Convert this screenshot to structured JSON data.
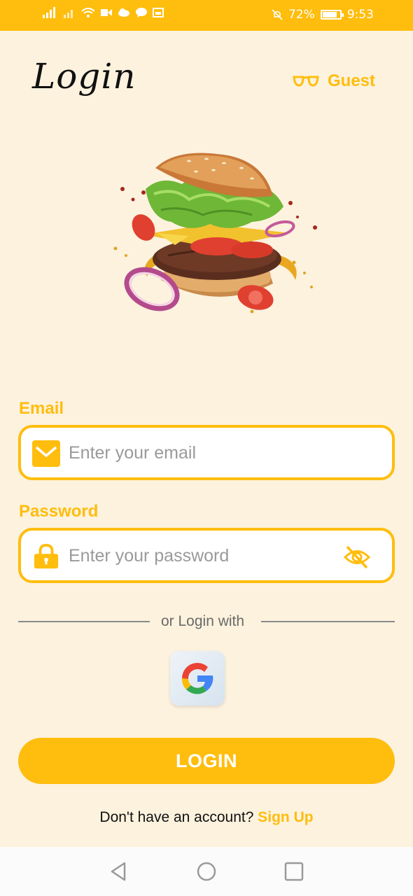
{
  "status_bar": {
    "battery_percent": "72%",
    "time": "9:53",
    "color": "#FFBD0D"
  },
  "header": {
    "title": "Login",
    "guest_label": "Guest",
    "guest_icon": "glasses-icon"
  },
  "form": {
    "email_label": "Email",
    "email_placeholder": "Enter your email",
    "email_icon": "mail-icon",
    "password_label": "Password",
    "password_placeholder": "Enter your password",
    "password_icon": "lock-icon",
    "visibility_icon": "eye-off-icon"
  },
  "social": {
    "divider_text": "or Login with",
    "google_icon": "google-icon"
  },
  "actions": {
    "login_label": "LOGIN",
    "signup_prompt": "Don't have an account?",
    "signup_link": "Sign Up"
  },
  "colors": {
    "accent": "#FFBD0D",
    "background": "#FCF2DE"
  }
}
